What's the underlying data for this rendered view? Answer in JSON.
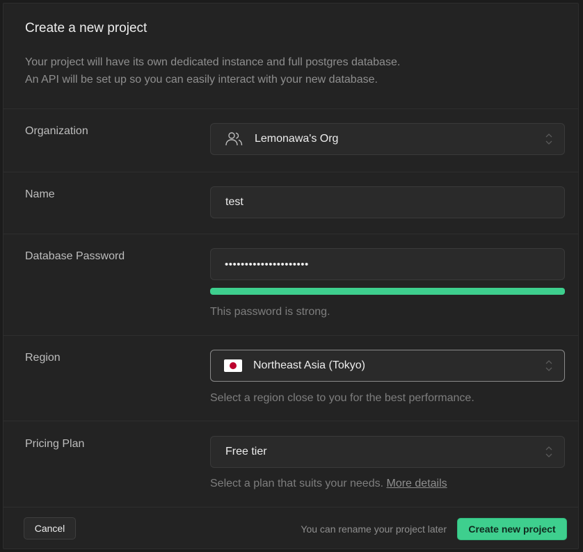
{
  "dialog": {
    "title": "Create a new project",
    "description_line1": "Your project will have its own dedicated instance and full postgres database.",
    "description_line2": "An API will be set up so you can easily interact with your new database."
  },
  "organization": {
    "label": "Organization",
    "value": "Lemonawa's Org",
    "icon": "users-icon"
  },
  "name": {
    "label": "Name",
    "value": "test"
  },
  "password": {
    "label": "Database Password",
    "value": "•••••••••••••••••••••",
    "strength_fraction": 1.0,
    "strength_color": "#3ecf8e",
    "strength_text": "This password is strong."
  },
  "region": {
    "label": "Region",
    "value": "Northeast Asia (Tokyo)",
    "flag": "japan-flag",
    "help": "Select a region close to you for the best performance."
  },
  "pricing": {
    "label": "Pricing Plan",
    "value": "Free tier",
    "help": "Select a plan that suits your needs.",
    "help_link": "More details"
  },
  "footer": {
    "cancel_label": "Cancel",
    "note": "You can rename your project later",
    "create_label": "Create new project"
  },
  "colors": {
    "accent": "#3ecf8e",
    "background": "#232323"
  }
}
